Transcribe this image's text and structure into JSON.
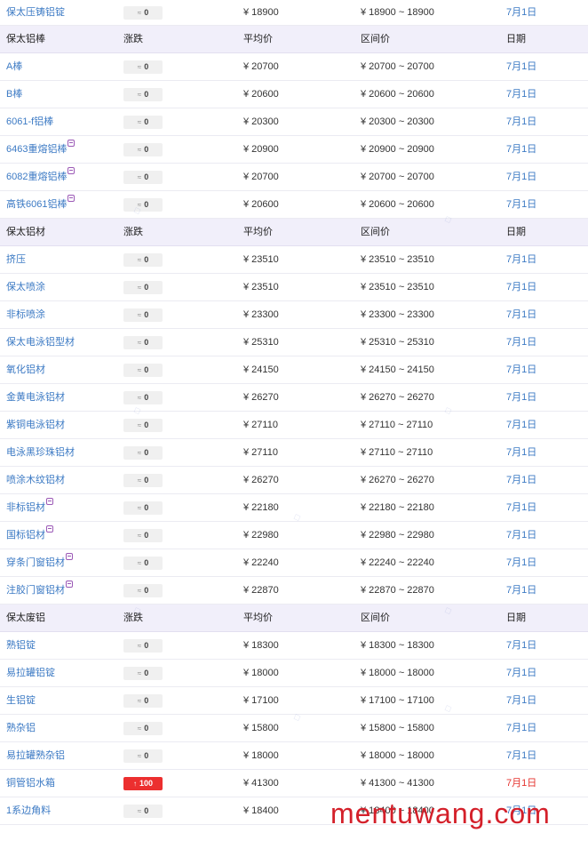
{
  "top_row": {
    "name": "保太压铸铝锭",
    "change": "0",
    "avg": "¥ 18900",
    "range": "¥ 18900 ~ 18900",
    "date": "7月1日"
  },
  "sections": [
    {
      "header": {
        "name": "保太铝棒",
        "change": "涨跌",
        "avg": "平均价",
        "range": "区间价",
        "date": "日期"
      },
      "rows": [
        {
          "name": "A棒",
          "change": "0",
          "avg": "¥ 20700",
          "range": "¥ 20700 ~ 20700",
          "date": "7月1日"
        },
        {
          "name": "B棒",
          "change": "0",
          "avg": "¥ 20600",
          "range": "¥ 20600 ~ 20600",
          "date": "7月1日"
        },
        {
          "name": "6061-f铝棒",
          "change": "0",
          "avg": "¥ 20300",
          "range": "¥ 20300 ~ 20300",
          "date": "7月1日"
        },
        {
          "name": "6463重熔铝棒",
          "change": "0",
          "avg": "¥ 20900",
          "range": "¥ 20900 ~ 20900",
          "date": "7月1日",
          "vip": true
        },
        {
          "name": "6082重熔铝棒",
          "change": "0",
          "avg": "¥ 20700",
          "range": "¥ 20700 ~ 20700",
          "date": "7月1日",
          "vip": true
        },
        {
          "name": "高铁6061铝棒",
          "change": "0",
          "avg": "¥ 20600",
          "range": "¥ 20600 ~ 20600",
          "date": "7月1日",
          "vip": true
        }
      ]
    },
    {
      "header": {
        "name": "保太铝材",
        "change": "涨跌",
        "avg": "平均价",
        "range": "区间价",
        "date": "日期"
      },
      "rows": [
        {
          "name": "挤压",
          "change": "0",
          "avg": "¥ 23510",
          "range": "¥ 23510 ~ 23510",
          "date": "7月1日"
        },
        {
          "name": "保太喷涂",
          "change": "0",
          "avg": "¥ 23510",
          "range": "¥ 23510 ~ 23510",
          "date": "7月1日"
        },
        {
          "name": "非标喷涂",
          "change": "0",
          "avg": "¥ 23300",
          "range": "¥ 23300 ~ 23300",
          "date": "7月1日"
        },
        {
          "name": "保太电泳铝型材",
          "change": "0",
          "avg": "¥ 25310",
          "range": "¥ 25310 ~ 25310",
          "date": "7月1日"
        },
        {
          "name": "氧化铝材",
          "change": "0",
          "avg": "¥ 24150",
          "range": "¥ 24150 ~ 24150",
          "date": "7月1日"
        },
        {
          "name": "金黄电泳铝材",
          "change": "0",
          "avg": "¥ 26270",
          "range": "¥ 26270 ~ 26270",
          "date": "7月1日"
        },
        {
          "name": "紫铜电泳铝材",
          "change": "0",
          "avg": "¥ 27110",
          "range": "¥ 27110 ~ 27110",
          "date": "7月1日"
        },
        {
          "name": "电泳黑珍珠铝材",
          "change": "0",
          "avg": "¥ 27110",
          "range": "¥ 27110 ~ 27110",
          "date": "7月1日"
        },
        {
          "name": "喷涂木纹铝材",
          "change": "0",
          "avg": "¥ 26270",
          "range": "¥ 26270 ~ 26270",
          "date": "7月1日"
        },
        {
          "name": "非标铝材",
          "change": "0",
          "avg": "¥ 22180",
          "range": "¥ 22180 ~ 22180",
          "date": "7月1日",
          "vip": true
        },
        {
          "name": "国标铝材",
          "change": "0",
          "avg": "¥ 22980",
          "range": "¥ 22980 ~ 22980",
          "date": "7月1日",
          "vip": true
        },
        {
          "name": "穿条门窗铝材",
          "change": "0",
          "avg": "¥ 22240",
          "range": "¥ 22240 ~ 22240",
          "date": "7月1日",
          "vip": true
        },
        {
          "name": "注胶门窗铝材",
          "change": "0",
          "avg": "¥ 22870",
          "range": "¥ 22870 ~ 22870",
          "date": "7月1日",
          "vip": true
        }
      ]
    },
    {
      "header": {
        "name": "保太废铝",
        "change": "涨跌",
        "avg": "平均价",
        "range": "区间价",
        "date": "日期"
      },
      "rows": [
        {
          "name": "熟铝锭",
          "change": "0",
          "avg": "¥ 18300",
          "range": "¥ 18300 ~ 18300",
          "date": "7月1日"
        },
        {
          "name": "易拉罐铝锭",
          "change": "0",
          "avg": "¥ 18000",
          "range": "¥ 18000 ~ 18000",
          "date": "7月1日"
        },
        {
          "name": "生铝锭",
          "change": "0",
          "avg": "¥ 17100",
          "range": "¥ 17100 ~ 17100",
          "date": "7月1日"
        },
        {
          "name": "熟杂铝",
          "change": "0",
          "avg": "¥ 15800",
          "range": "¥ 15800 ~ 15800",
          "date": "7月1日"
        },
        {
          "name": "易拉罐熟杂铝",
          "change": "0",
          "avg": "¥ 18000",
          "range": "¥ 18000 ~ 18000",
          "date": "7月1日"
        },
        {
          "name": "铜管铝水箱",
          "change": "100",
          "avg": "¥ 41300",
          "range": "¥ 41300 ~ 41300",
          "date": "7月1日",
          "up": true
        },
        {
          "name": "1系边角料",
          "change": "0",
          "avg": "¥ 18400",
          "range": "¥ 18400 ~ 18400",
          "date": "7月1日"
        }
      ]
    }
  ],
  "watermark": "mentuwang.com",
  "colors": {
    "link": "#3c7ac4",
    "header_bg": "#f1effa",
    "up_badge": "#ec2f2f",
    "watermark": "#d4202a"
  }
}
